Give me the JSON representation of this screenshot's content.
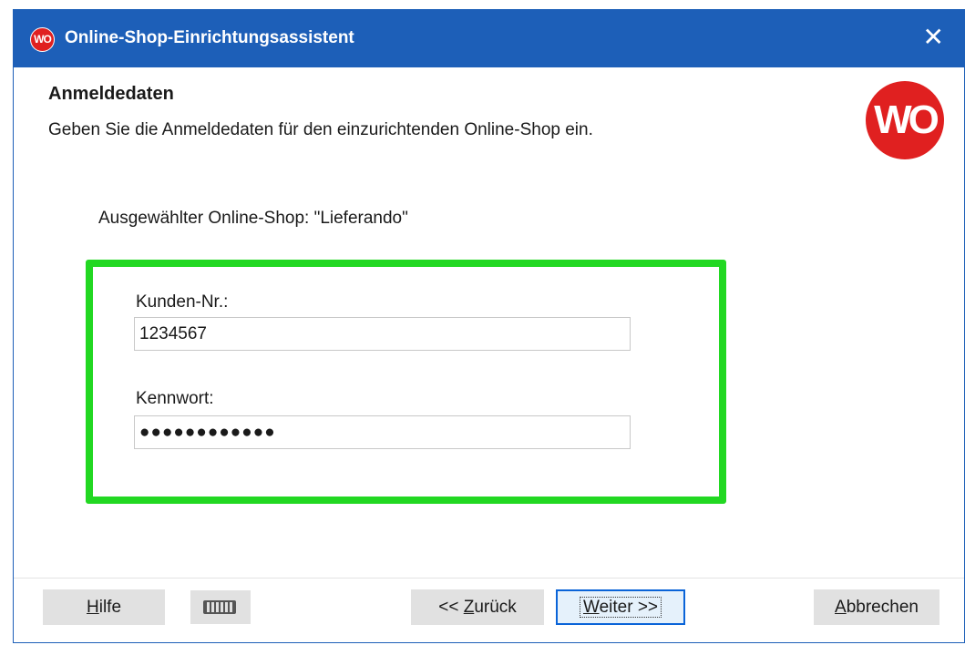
{
  "window": {
    "title": "Online-Shop-Einrichtungsassistent",
    "close_glyph": "✕",
    "accent_color": "#1d5fb8",
    "logo_text": "WO"
  },
  "page": {
    "heading": "Anmeldedaten",
    "subheading": "Geben Sie die Anmeldedaten für den einzurichtenden Online-Shop ein.",
    "logo_text": "WO",
    "selected_shop": "Ausgewählter Online-Shop: \"Lieferando\"",
    "highlight_color": "#22d822"
  },
  "form": {
    "customer_label": "Kunden-Nr.:",
    "customer_value": "1234567",
    "password_label": "Kennwort:",
    "password_value": "●●●●●●●●●●●●"
  },
  "footer": {
    "help": {
      "mnemonic": "H",
      "rest": "ilfe"
    },
    "keyboard_icon": "keyboard-icon",
    "back": {
      "prefix": "<< ",
      "mnemonic": "Z",
      "rest": "urück"
    },
    "next": {
      "mnemonic": "W",
      "rest": "eiter >>"
    },
    "cancel": {
      "mnemonic": "A",
      "rest": "bbrechen"
    }
  }
}
